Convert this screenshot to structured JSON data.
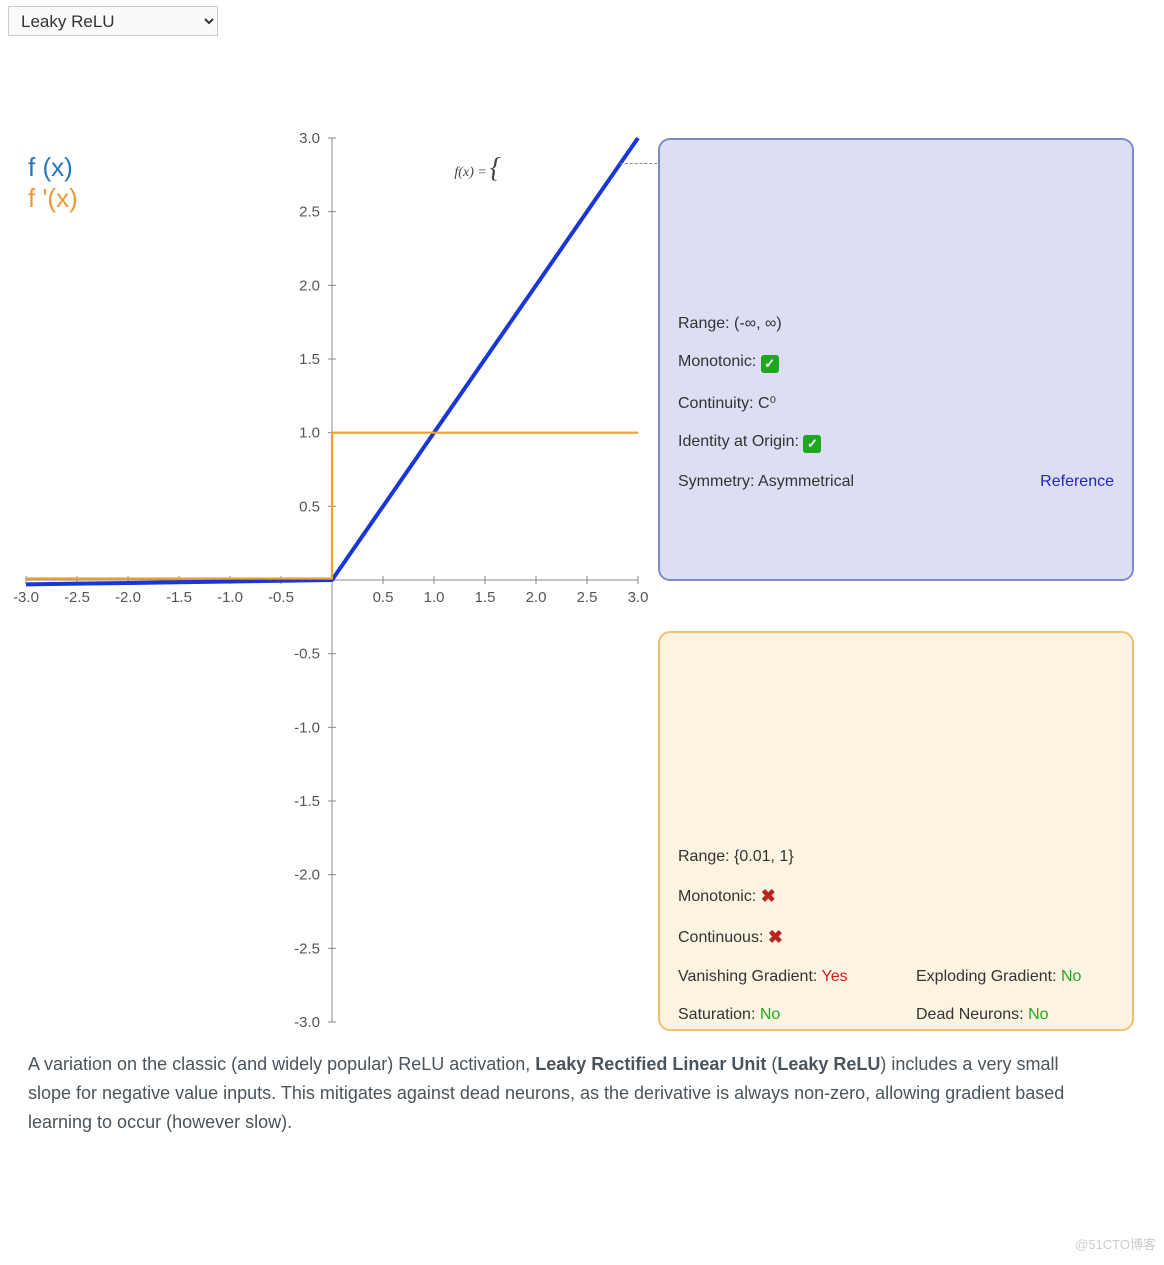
{
  "selector": {
    "value": "Leaky ReLU"
  },
  "legend": {
    "fx": "f (x)",
    "fpx": "f '(x)"
  },
  "formula_label": "f(x) =",
  "chart_data": {
    "type": "line",
    "title": "",
    "xlabel": "",
    "ylabel": "",
    "xlim": [
      -3,
      3
    ],
    "ylim": [
      -3,
      3
    ],
    "xticks": [
      -3.0,
      -2.5,
      -2.0,
      -1.5,
      -1.0,
      -0.5,
      0.5,
      1.0,
      1.5,
      2.0,
      2.5,
      3.0
    ],
    "yticks": [
      -3.0,
      -2.5,
      -2.0,
      -1.5,
      -1.0,
      -0.5,
      0.5,
      1.0,
      1.5,
      2.0,
      2.5,
      3.0
    ],
    "series": [
      {
        "name": "f(x)",
        "color": "#1936d6",
        "x": [
          -3,
          -2.5,
          -2,
          -1.5,
          -1,
          -0.5,
          0,
          0.5,
          1,
          1.5,
          2,
          2.5,
          3
        ],
        "y": [
          -0.03,
          -0.025,
          -0.02,
          -0.015,
          -0.01,
          -0.005,
          0,
          0.5,
          1,
          1.5,
          2,
          2.5,
          3
        ]
      },
      {
        "name": "f'(x)",
        "color": "#f2a030",
        "x": [
          -3,
          -0.001,
          0,
          0.001,
          3
        ],
        "y": [
          0.01,
          0.01,
          0.01,
          1,
          1
        ]
      }
    ]
  },
  "info_fx": {
    "range_label": "Range:",
    "range_value": "(-∞, ∞)",
    "monotonic_label": "Monotonic:",
    "monotonic_value": "check",
    "continuity_label": "Continuity:",
    "continuity_value": "C⁰",
    "identity_label": "Identity at Origin:",
    "identity_value": "check",
    "symmetry_label": "Symmetry:",
    "symmetry_value": "Asymmetrical",
    "reference": "Reference"
  },
  "info_fpx": {
    "range_label": "Range:",
    "range_value": "{0.01, 1}",
    "monotonic_label": "Monotonic:",
    "monotonic_value": "x",
    "continuous_label": "Continuous:",
    "continuous_value": "x",
    "vanishing_label": "Vanishing Gradient:",
    "vanishing_value": "Yes",
    "exploding_label": "Exploding Gradient:",
    "exploding_value": "No",
    "saturation_label": "Saturation:",
    "saturation_value": "No",
    "dead_label": "Dead Neurons:",
    "dead_value": "No"
  },
  "description": {
    "pre": "A variation on the classic (and widely popular) ReLU activation, ",
    "bold1": "Leaky Rectified Linear Unit",
    "mid": " (",
    "bold2": "Leaky ReLU",
    "post": ") includes a very small slope for negative value inputs. This mitigates against dead neurons, as the derivative is always non-zero, allowing gradient based learning to occur (however slow)."
  },
  "watermark": "@51CTO博客"
}
